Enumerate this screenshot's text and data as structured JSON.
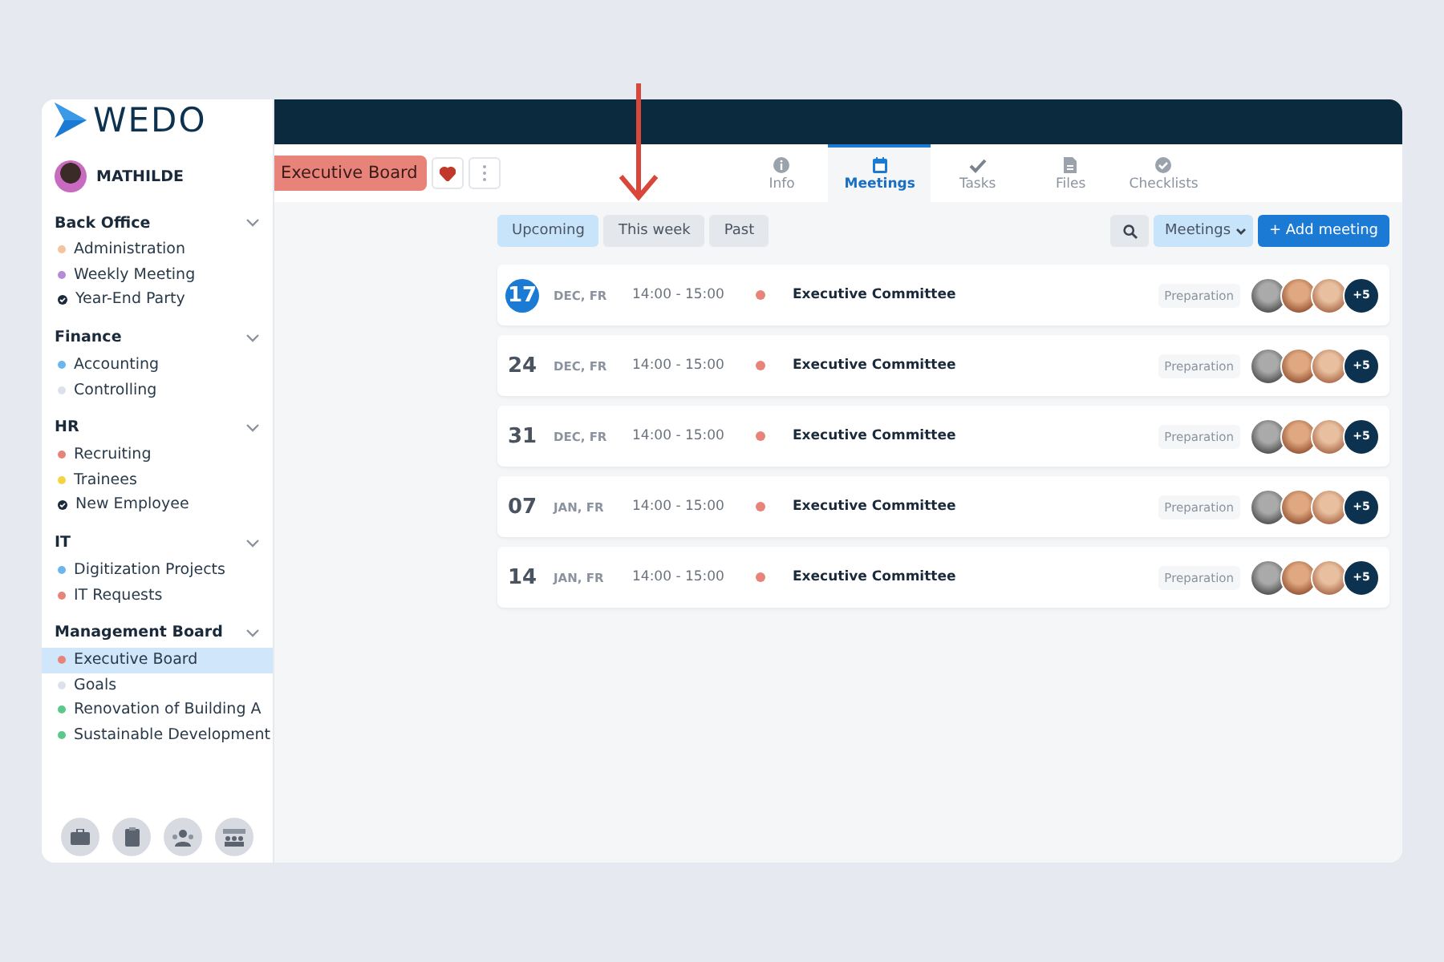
{
  "sidebar": {
    "logo": "WEDO",
    "user": {
      "name": "MATHILDE"
    },
    "groups": [
      {
        "title": "Back Office",
        "expanded": true,
        "items": [
          {
            "label": "Administration",
            "kind": "dot",
            "color": "#f2c4a0",
            "selected": false
          },
          {
            "label": "Weekly Meeting",
            "kind": "dot",
            "color": "#b58ad6",
            "selected": false
          },
          {
            "label": "Year-End Party",
            "kind": "done",
            "selected": false
          }
        ]
      },
      {
        "title": "Finance",
        "expanded": true,
        "items": [
          {
            "label": "Accounting",
            "kind": "dot",
            "color": "#6cb6f0",
            "selected": false
          },
          {
            "label": "Controlling",
            "kind": "dot",
            "color": "#dde2ea",
            "selected": false
          }
        ]
      },
      {
        "title": "HR",
        "expanded": true,
        "items": [
          {
            "label": "Recruiting",
            "kind": "dot",
            "color": "#e8837a",
            "selected": false
          },
          {
            "label": "Trainees",
            "kind": "dot",
            "color": "#f5d442",
            "selected": false
          },
          {
            "label": "New Employee",
            "kind": "done",
            "selected": false
          }
        ]
      },
      {
        "title": "IT",
        "expanded": true,
        "items": [
          {
            "label": "Digitization Projects",
            "kind": "dot",
            "color": "#6cb6f0",
            "selected": false
          },
          {
            "label": "IT Requests",
            "kind": "dot",
            "color": "#e8837a",
            "selected": false
          }
        ]
      },
      {
        "title": "Management Board",
        "expanded": true,
        "items": [
          {
            "label": "Executive Board",
            "kind": "dot",
            "color": "#e8837a",
            "selected": true
          },
          {
            "label": "Goals",
            "kind": "dot",
            "color": "#dde2ea",
            "selected": false
          },
          {
            "label": "Renovation of Building A",
            "kind": "dot",
            "color": "#5cc98a",
            "selected": false
          },
          {
            "label": "Sustainable Development",
            "kind": "dot",
            "color": "#5cc98a",
            "selected": false
          }
        ]
      }
    ]
  },
  "header": {
    "board": "Executive Board",
    "favorite": true,
    "tabs": [
      {
        "label": "Info",
        "selected": false
      },
      {
        "label": "Meetings",
        "selected": true
      },
      {
        "label": "Tasks",
        "selected": false
      },
      {
        "label": "Files",
        "selected": false
      },
      {
        "label": "Checklists",
        "selected": false
      }
    ]
  },
  "filters": [
    {
      "label": "Upcoming",
      "selected": true
    },
    {
      "label": "This week",
      "selected": false
    },
    {
      "label": "Past",
      "selected": false
    }
  ],
  "view_menu": "Meetings",
  "add_button": "+ Add meeting",
  "meetings": [
    {
      "day": "17",
      "date": "DEC, FR",
      "time": "14:00 - 15:00",
      "color": "#e8837a",
      "title": "Executive Committee",
      "tag": "Preparation",
      "more": "+5",
      "today": true
    },
    {
      "day": "24",
      "date": "DEC, FR",
      "time": "14:00 - 15:00",
      "color": "#e8837a",
      "title": "Executive Committee",
      "tag": "Preparation",
      "more": "+5",
      "today": false
    },
    {
      "day": "31",
      "date": "DEC, FR",
      "time": "14:00 - 15:00",
      "color": "#e8837a",
      "title": "Executive Committee",
      "tag": "Preparation",
      "more": "+5",
      "today": false
    },
    {
      "day": "07",
      "date": "JAN, FR",
      "time": "14:00 - 15:00",
      "color": "#e8837a",
      "title": "Executive Committee",
      "tag": "Preparation",
      "more": "+5",
      "today": false
    },
    {
      "day": "14",
      "date": "JAN, FR",
      "time": "14:00 - 15:00",
      "color": "#e8837a",
      "title": "Executive Committee",
      "tag": "Preparation",
      "more": "+5",
      "today": false
    }
  ]
}
